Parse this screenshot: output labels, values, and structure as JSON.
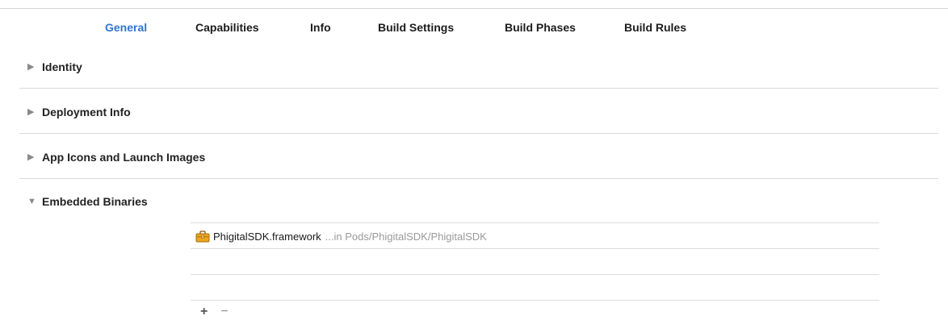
{
  "tabs": [
    {
      "label": "General",
      "active": true
    },
    {
      "label": "Capabilities",
      "active": false
    },
    {
      "label": "Info",
      "active": false
    },
    {
      "label": "Build Settings",
      "active": false
    },
    {
      "label": "Build Phases",
      "active": false
    },
    {
      "label": "Build Rules",
      "active": false
    }
  ],
  "sections": [
    {
      "label": "Identity",
      "expanded": false,
      "icon": "disclosure-triangle-right-icon"
    },
    {
      "label": "Deployment Info",
      "expanded": false,
      "icon": "disclosure-triangle-right-icon"
    },
    {
      "label": "App Icons and Launch Images",
      "expanded": false,
      "icon": "disclosure-triangle-right-icon"
    },
    {
      "label": "Embedded Binaries",
      "expanded": true,
      "icon": "disclosure-triangle-down-icon"
    }
  ],
  "embedded_binaries": {
    "items": [
      {
        "name": "PhigitalSDK.framework",
        "path": "...in Pods/PhigitalSDK/PhigitalSDK",
        "icon": "framework-toolbox-icon"
      }
    ],
    "add_label": "+",
    "remove_label": "−"
  },
  "colors": {
    "active_tab": "#2f76d2",
    "divider": "#d9d9d9",
    "path_text": "#9a9a9a",
    "framework_icon": "#e9a820"
  }
}
